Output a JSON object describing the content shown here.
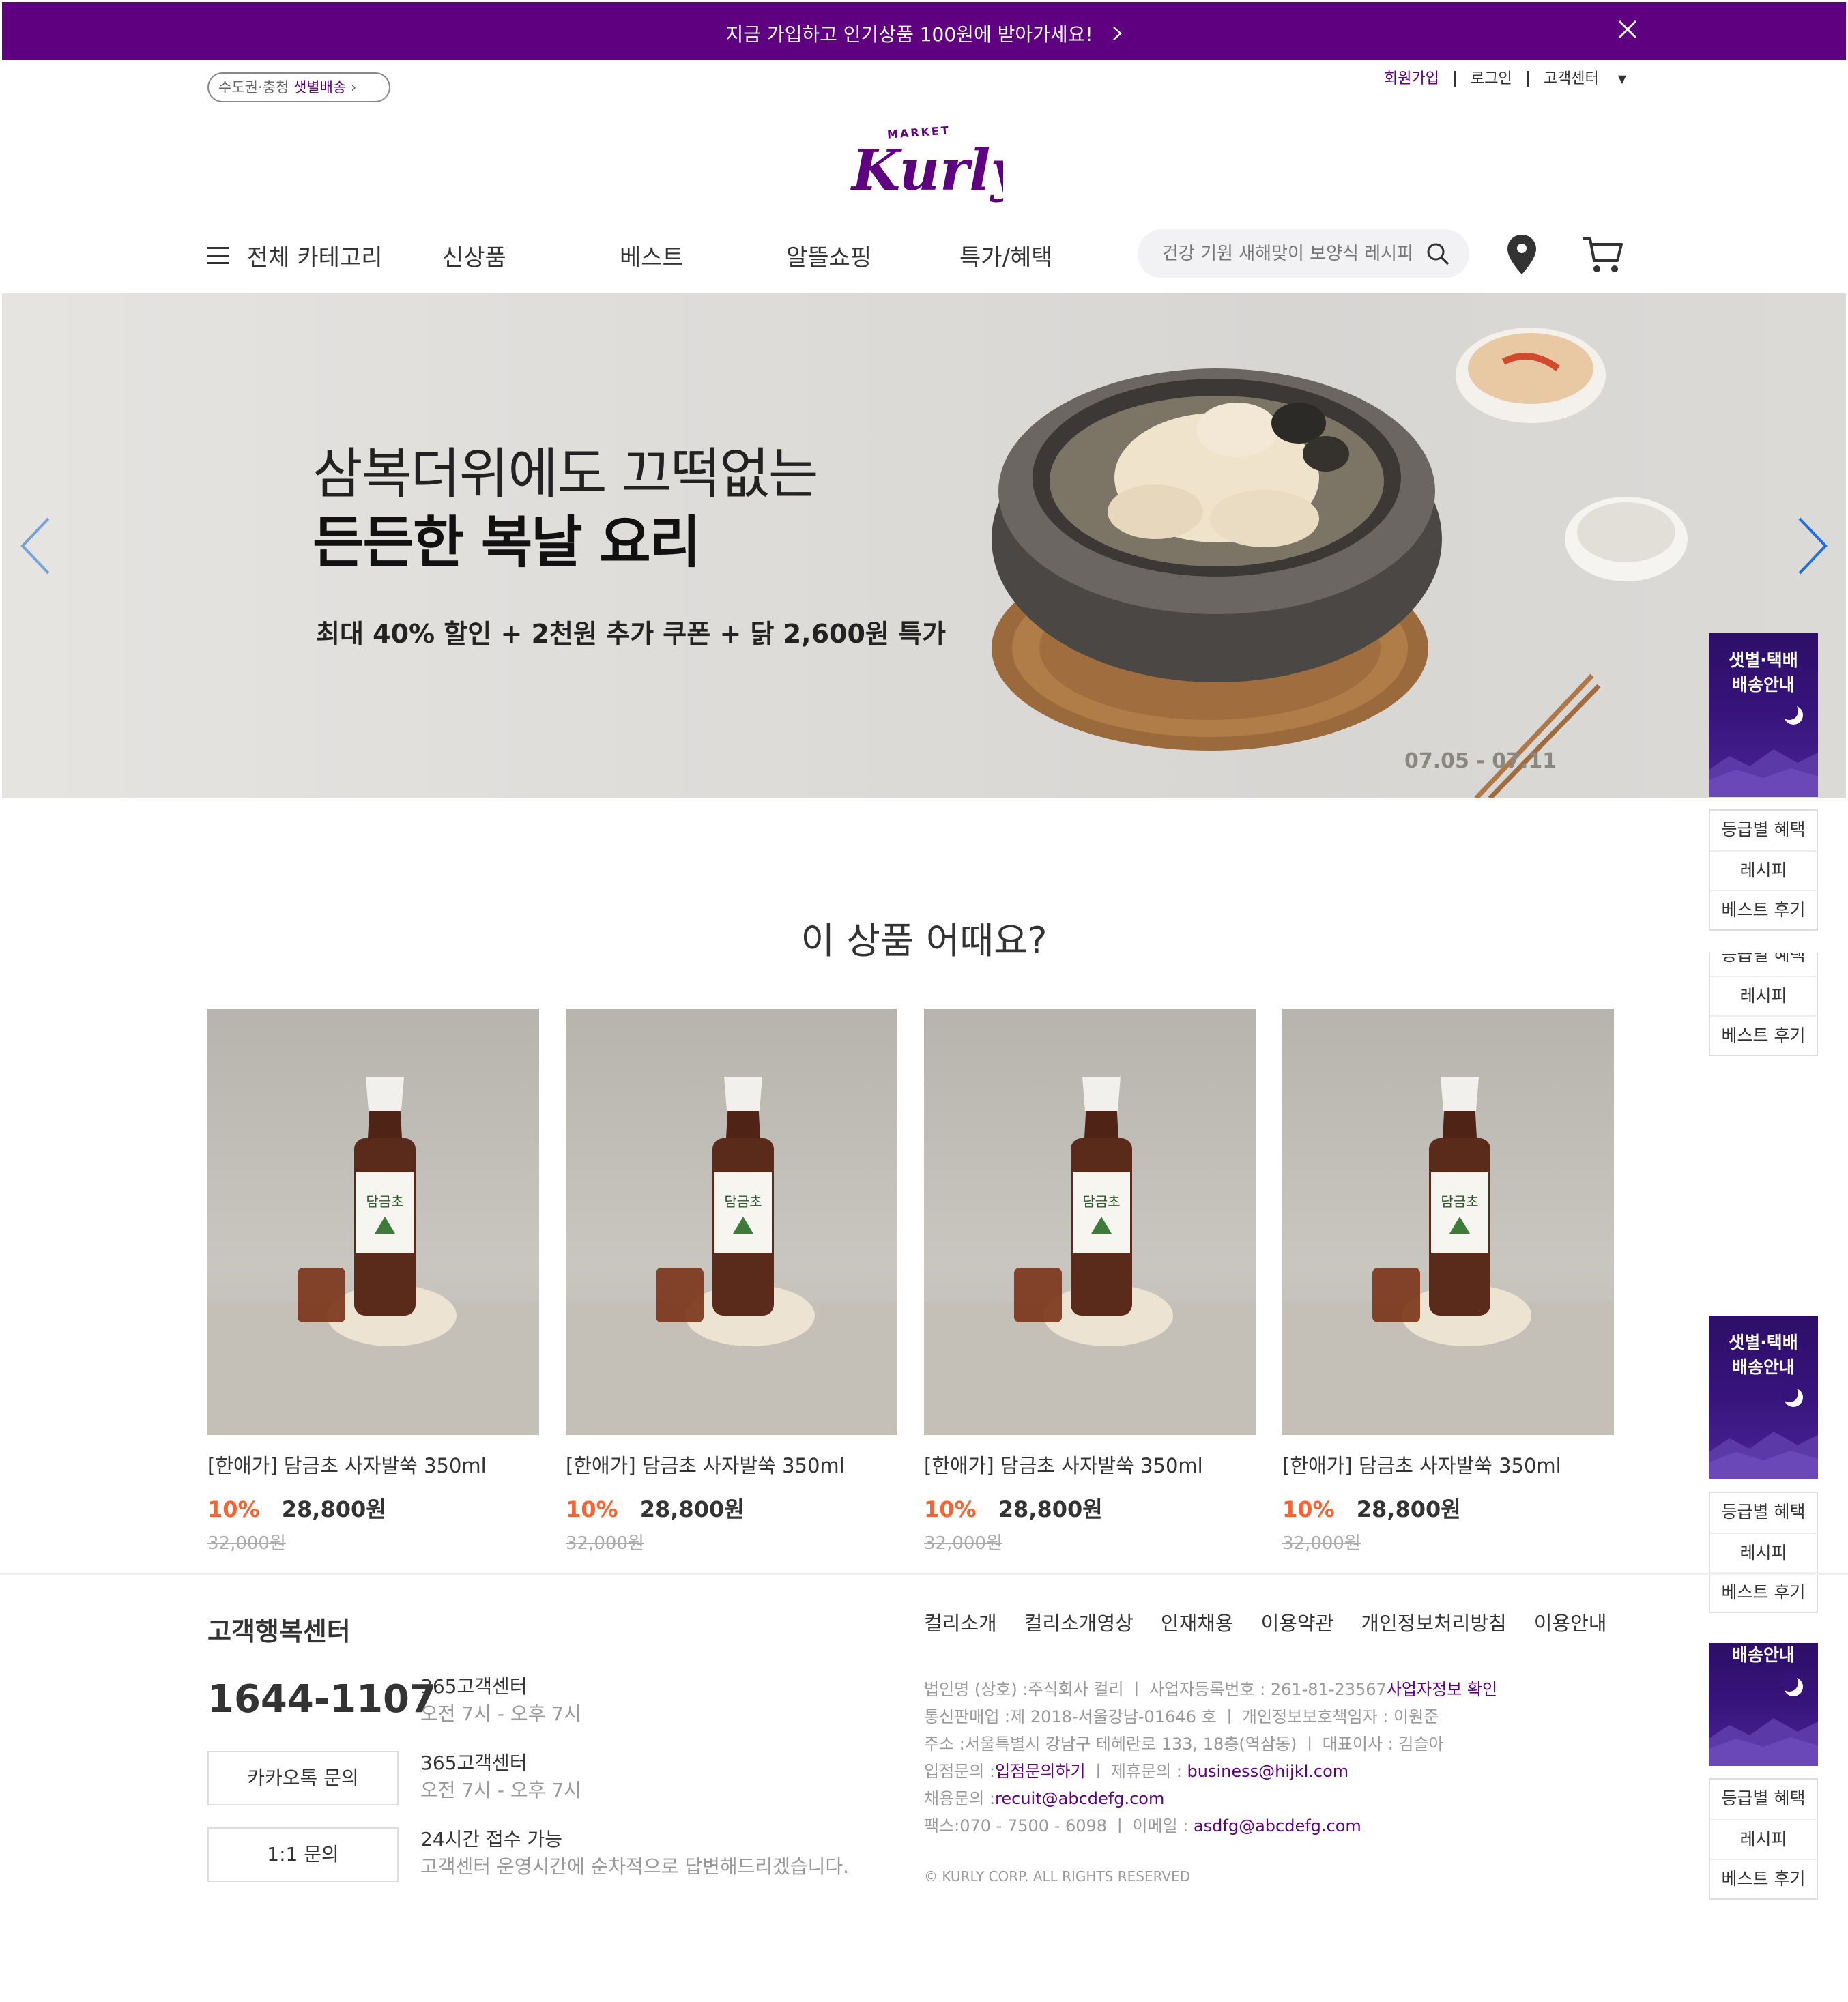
{
  "colors": {
    "brand": "#5f0080",
    "sale": "#fa622f",
    "banner_bg": "#5f0080"
  },
  "top_banner": {
    "message": "지금 가입하고 인기상품 100원에 받아가세요!",
    "close_icon": "close-icon",
    "chevron_icon": "chevron-right-icon"
  },
  "header": {
    "dawn_delivery_region": "수도권·충청",
    "dawn_delivery_label": "샛별배송",
    "user_menu": [
      "회원가입",
      "로그인",
      "고객센터"
    ],
    "logo": {
      "top_text": "MARKET",
      "main_text": "Kurly"
    }
  },
  "gnb": {
    "all_categories": "전체 카테고리",
    "items": [
      "신상품",
      "베스트",
      "알뜰쇼핑",
      "특가/혜택"
    ],
    "search_placeholder": "건강 기원 새해맞이 보양식 레시피"
  },
  "hero": {
    "line1": "삼복더위에도 끄떡없는",
    "line2": "든든한 복날 요리",
    "line3": "최대 40% 할인 + 2천원 추가 쿠폰 + 닭 2,600원 특가",
    "dates": "07.05 - 07.11"
  },
  "recommend": {
    "title": "이 상품 어때요?",
    "products": [
      {
        "name": "[한애가] 담금초 사자발쑥 350ml",
        "rate": "10%",
        "price": "28,800원",
        "original": "32,000원",
        "label_text": "담금초"
      },
      {
        "name": "[한애가] 담금초 사자발쑥 350ml",
        "rate": "10%",
        "price": "28,800원",
        "original": "32,000원",
        "label_text": "담금초"
      },
      {
        "name": "[한애가] 담금초 사자발쑥 350ml",
        "rate": "10%",
        "price": "28,800원",
        "original": "32,000원",
        "label_text": "담금초"
      },
      {
        "name": "[한애가] 담금초 사자발쑥 350ml",
        "rate": "10%",
        "price": "28,800원",
        "original": "32,000원",
        "label_text": "담금초"
      }
    ]
  },
  "side_banner": {
    "dawn_title_1": "샛별·택배",
    "dawn_title_2": "배송안내",
    "links": [
      "등급별 혜택",
      "레시피",
      "베스트 후기"
    ]
  },
  "footer": {
    "cs_title": "고객행복센터",
    "phone": "1644-1107",
    "buttons": [
      "카카오톡 문의",
      "1:1 문의"
    ],
    "info": [
      {
        "title": "365고객센터",
        "sub": "오전 7시 - 오후 7시"
      },
      {
        "title": "365고객센터",
        "sub": "오전 7시 - 오후 7시"
      },
      {
        "title": "24시간 접수 가능",
        "sub": "고객센터 운영시간에 순차적으로 답변해드리겠습니다."
      }
    ],
    "nav": [
      "컬리소개",
      "컬리소개영상",
      "인재채용",
      "이용약관",
      "개인정보처리방침",
      "이용안내"
    ],
    "company": {
      "line1_a": "법인명 (상호) :주식회사 컬리 ㅣ 사업자등록번호 : 261-81-23567",
      "line1_link": "사업자정보 확인",
      "line2": "통신판매업 :제 2018-서울강남-01646 호 ㅣ 개인정보보호책임자 : 이원준",
      "line3": "주소 :서울특별시 강남구 테헤란로 133, 18층(역삼동) ㅣ 대표이사 : 김슬아",
      "line4_a": "입점문의 :",
      "line4_link": "입점문의하기",
      "line4_b": " ㅣ 제휴문의 : ",
      "line4_email": "business@hijkl.com",
      "line5_a": "채용문의 :",
      "line5_email": "recuit@abcdefg.com",
      "line6_a": "팩스:070 - 7500 - 6098 ㅣ 이메일 : ",
      "line6_email": "asdfg@abcdefg.com"
    },
    "copyright": "© KURLY CORP. ALL RIGHTS RESERVED"
  }
}
